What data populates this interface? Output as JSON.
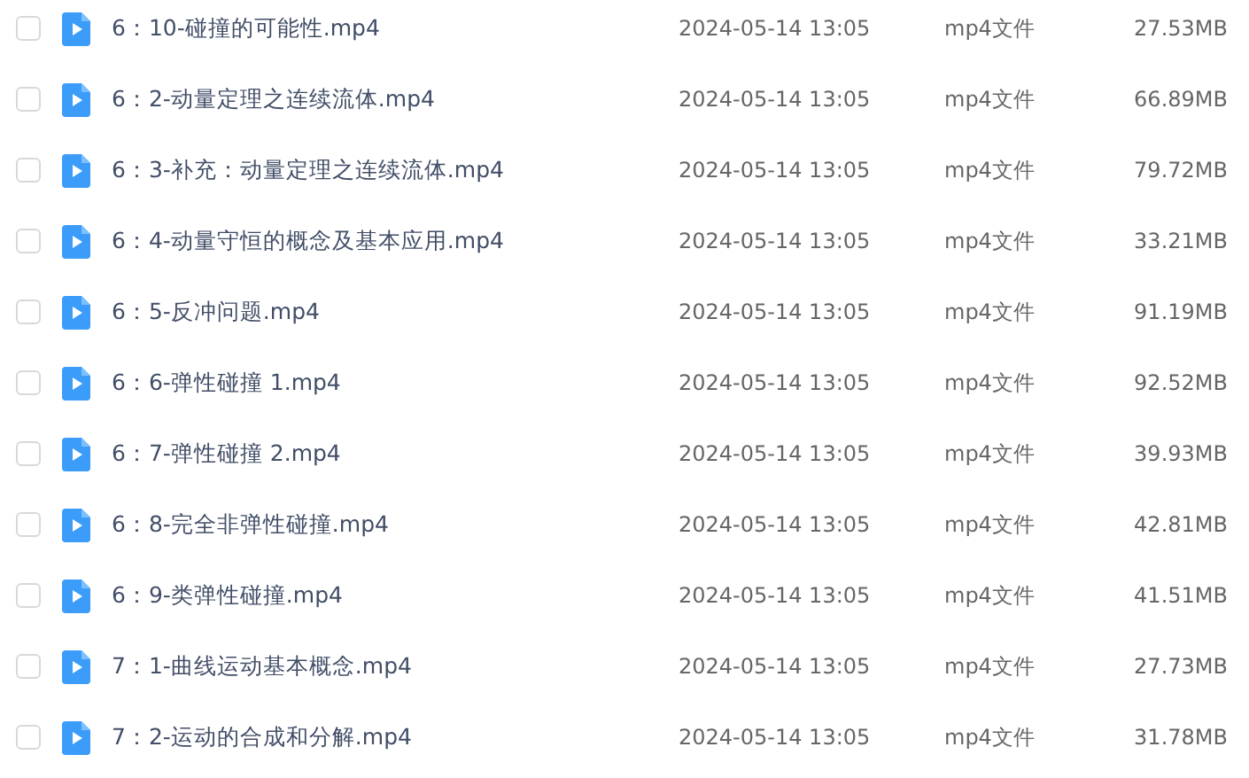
{
  "files": [
    {
      "name": "6：10-碰撞的可能性.mp4",
      "checked": false,
      "date": "2024-05-14 13:05",
      "type": "mp4文件",
      "size": "27.53MB"
    },
    {
      "name": "6：2-动量定理之连续流体.mp4",
      "checked": false,
      "date": "2024-05-14 13:05",
      "type": "mp4文件",
      "size": "66.89MB"
    },
    {
      "name": "6：3-补充：动量定理之连续流体.mp4",
      "checked": false,
      "date": "2024-05-14 13:05",
      "type": "mp4文件",
      "size": "79.72MB"
    },
    {
      "name": "6：4-动量守恒的概念及基本应用.mp4",
      "checked": false,
      "date": "2024-05-14 13:05",
      "type": "mp4文件",
      "size": "33.21MB"
    },
    {
      "name": "6：5-反冲问题.mp4",
      "checked": false,
      "date": "2024-05-14 13:05",
      "type": "mp4文件",
      "size": "91.19MB"
    },
    {
      "name": "6：6-弹性碰撞 1.mp4",
      "checked": false,
      "date": "2024-05-14 13:05",
      "type": "mp4文件",
      "size": "92.52MB"
    },
    {
      "name": "6：7-弹性碰撞 2.mp4",
      "checked": false,
      "date": "2024-05-14 13:05",
      "type": "mp4文件",
      "size": "39.93MB"
    },
    {
      "name": "6：8-完全非弹性碰撞.mp4",
      "checked": false,
      "date": "2024-05-14 13:05",
      "type": "mp4文件",
      "size": "42.81MB"
    },
    {
      "name": "6：9-类弹性碰撞.mp4",
      "checked": false,
      "date": "2024-05-14 13:05",
      "type": "mp4文件",
      "size": "41.51MB"
    },
    {
      "name": "7：1-曲线运动基本概念.mp4",
      "checked": false,
      "date": "2024-05-14 13:05",
      "type": "mp4文件",
      "size": "27.73MB"
    },
    {
      "name": "7：2-运动的合成和分解.mp4",
      "checked": false,
      "date": "2024-05-14 13:05",
      "type": "mp4文件",
      "size": "31.78MB"
    }
  ]
}
